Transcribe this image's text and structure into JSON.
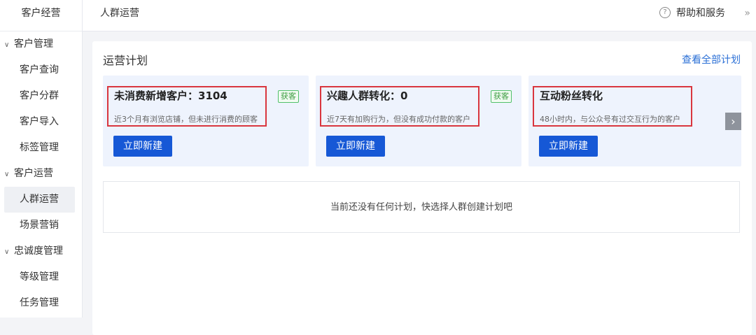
{
  "sidebar": {
    "top": "客户经营",
    "groups": [
      {
        "label": "客户管理",
        "items": [
          "客户查询",
          "客户分群",
          "客户导入",
          "标签管理"
        ]
      },
      {
        "label": "客户运营",
        "items": [
          "人群运营",
          "场景营销"
        ]
      },
      {
        "label": "忠诚度管理",
        "items": [
          "等级管理",
          "任务管理"
        ]
      }
    ],
    "active_item": "人群运营"
  },
  "topbar": {
    "title": "人群运营",
    "help_icon": "?",
    "help_label": "帮助和服务",
    "expand_icon": "»"
  },
  "plans": {
    "title": "运营计划",
    "view_all": "查看全部计划",
    "cards": [
      {
        "title": "未消费新增客户：3104",
        "tag": "获客",
        "desc": "近3个月有浏览店铺，但未进行消费的顾客",
        "button": "立即新建"
      },
      {
        "title": "兴趣人群转化：0",
        "tag": "获客",
        "desc": "近7天有加购行为，但没有成功付款的客户",
        "button": "立即新建"
      },
      {
        "title": "互动粉丝转化",
        "tag": "",
        "desc": "48小时内，与公众号有过交互行为的客户",
        "button": "立即新建"
      }
    ],
    "next_icon": "›",
    "empty_text": "当前还没有任何计划，快选择人群创建计划吧"
  },
  "colors": {
    "primary": "#1658d6",
    "link": "#2a6fd6",
    "highlight_border": "#d9363e",
    "tag_green": "#3a9c3f",
    "card_bg": "#eef3fd"
  }
}
